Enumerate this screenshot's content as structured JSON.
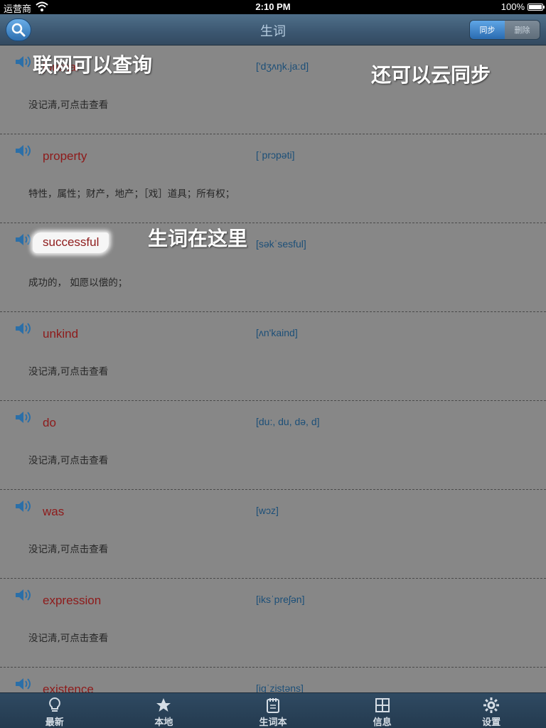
{
  "status_bar": {
    "carrier": "运营商",
    "time": "2:10 PM",
    "battery": "100%"
  },
  "nav": {
    "title": "生词",
    "sync_label": "同步",
    "delete_label": "删除"
  },
  "words": [
    {
      "word": "journal",
      "phonetic": "['dʒʌŋk.ja:d]",
      "definition": "没记清,可点击查看"
    },
    {
      "word": "property",
      "phonetic": "[ˈprɔpəti]",
      "definition": "特性，属性；财产，地产；［戏］道具；所有权；"
    },
    {
      "word": "successful",
      "phonetic": "[səkˈsesful]",
      "definition": "成功的，  如愿以偿的；"
    },
    {
      "word": "unkind",
      "phonetic": "[ʌn'kaind]",
      "definition": "没记清,可点击查看"
    },
    {
      "word": "do",
      "phonetic": "[du:, du, də, d]",
      "definition": "没记清,可点击查看"
    },
    {
      "word": "was",
      "phonetic": "[wɔz]",
      "definition": "没记清,可点击查看"
    },
    {
      "word": "expression",
      "phonetic": "[iksˈpreʃən]",
      "definition": "没记清,可点击查看"
    },
    {
      "word": "existence",
      "phonetic": "[igˈzistəns]",
      "definition": ""
    }
  ],
  "captions": {
    "online_lookup": "联网可以查询",
    "cloud_sync": "还可以云同步",
    "words_here": "生词在这里"
  },
  "tabs": [
    {
      "label": "最新",
      "icon": "lightbulb-icon"
    },
    {
      "label": "本地",
      "icon": "star-icon"
    },
    {
      "label": "生词本",
      "icon": "notebook-icon"
    },
    {
      "label": "信息",
      "icon": "grid-icon"
    },
    {
      "label": "设置",
      "icon": "gear-icon"
    }
  ]
}
